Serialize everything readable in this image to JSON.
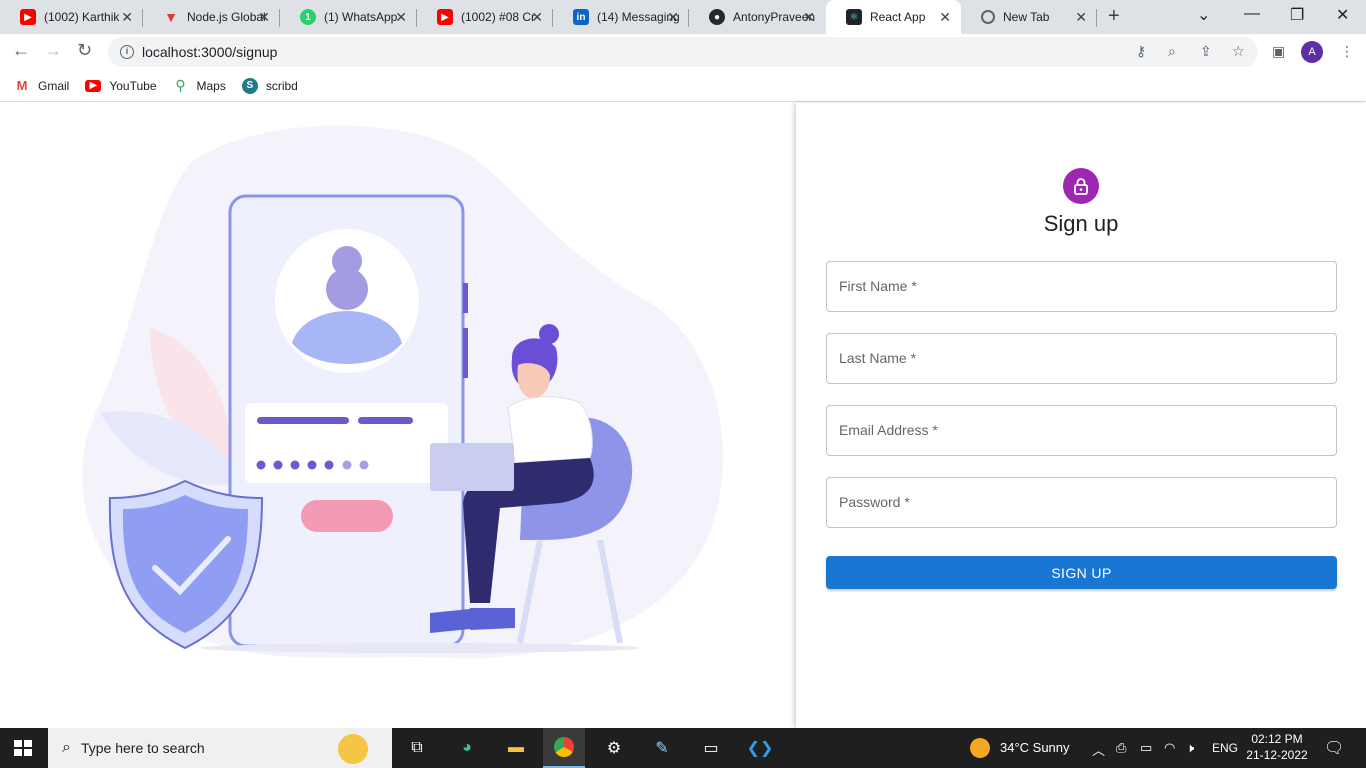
{
  "browser": {
    "tabs": [
      {
        "title": "(1002) Karthik",
        "icon": "youtube-icon",
        "color": "#ff0000"
      },
      {
        "title": "Node.js Global",
        "icon": "vercel-icon",
        "color": "#e53935"
      },
      {
        "title": "(1) WhatsApp",
        "icon": "whatsapp-icon",
        "color": "#25d366",
        "badge": "1"
      },
      {
        "title": "(1002) #08 Cr",
        "icon": "youtube-icon",
        "color": "#ff0000"
      },
      {
        "title": "(14) Messaging",
        "icon": "linkedin-icon",
        "color": "#0a66c2",
        "badge": "in"
      },
      {
        "title": "AntonyPraveen",
        "icon": "github-icon",
        "color": "#24292e"
      },
      {
        "title": "React App",
        "icon": "react-icon",
        "color": "#61dafb"
      },
      {
        "title": "New Tab",
        "icon": "chrome-icon",
        "color": "#5f6368"
      }
    ],
    "url": "localhost:3000/signup",
    "profile_initial": "A",
    "bookmarks": [
      {
        "label": "Gmail",
        "icon": "gmail-icon"
      },
      {
        "label": "YouTube",
        "icon": "youtube-icon"
      },
      {
        "label": "Maps",
        "icon": "maps-icon"
      },
      {
        "label": "scribd",
        "icon": "scribd-icon"
      }
    ]
  },
  "signup": {
    "heading": "Sign up",
    "fields": [
      {
        "label": "First Name *",
        "value": ""
      },
      {
        "label": "Last Name *",
        "value": ""
      },
      {
        "label": "Email Address *",
        "value": ""
      },
      {
        "label": "Password *",
        "value": ""
      }
    ],
    "submit_label": "SIGN UP"
  },
  "taskbar": {
    "search_placeholder": "Type here to search",
    "weather": "34°C  Sunny",
    "language": "ENG",
    "time": "02:12 PM",
    "date": "21-12-2022"
  }
}
